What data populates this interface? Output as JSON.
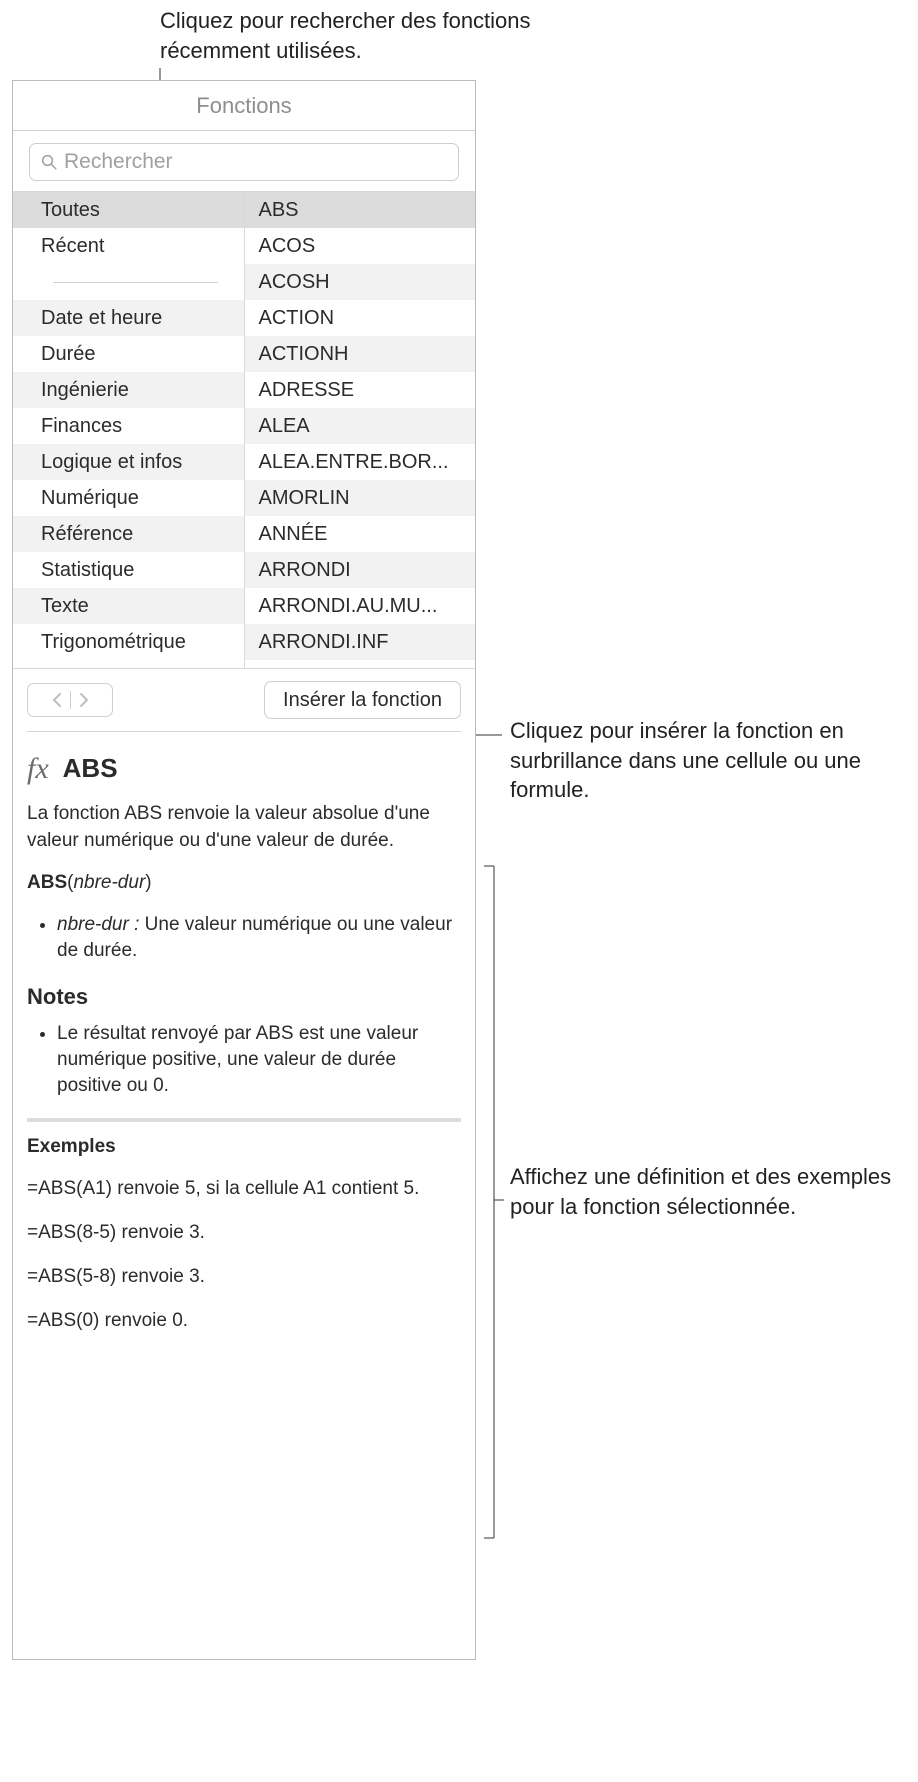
{
  "callouts": {
    "top": "Cliquez pour rechercher des fonctions récemment utilisées.",
    "insert": "Cliquez pour insérer la fonction en surbrillance dans une cellule ou une formule.",
    "definition": "Affichez une définition et des exemples pour la fonction sélectionnée."
  },
  "panel": {
    "title": "Fonctions",
    "search_placeholder": "Rechercher",
    "categories": [
      "Toutes",
      "Récent",
      "",
      "Date et heure",
      "Durée",
      "Ingénierie",
      "Finances",
      "Logique et infos",
      "Numérique",
      "Référence",
      "Statistique",
      "Texte",
      "Trigonométrique"
    ],
    "functions": [
      "ABS",
      "ACOS",
      "ACOSH",
      "ACTION",
      "ACTIONH",
      "ADRESSE",
      "ALEA",
      "ALEA.ENTRE.BOR...",
      "AMORLIN",
      "ANNÉE",
      "ARRONDI",
      "ARRONDI.AU.MU...",
      "ARRONDI.INF"
    ],
    "insert_label": "Insérer la fonction"
  },
  "doc": {
    "fx_symbol": "fx",
    "name": "ABS",
    "summary": "La fonction ABS renvoie la valeur absolue d'une valeur numérique ou d'une valeur de durée.",
    "syntax_name": "ABS",
    "syntax_arg": "nbre-dur",
    "arg_label": "nbre-dur :",
    "arg_desc": "Une valeur numérique ou une valeur de durée.",
    "notes_heading": "Notes",
    "note1": "Le résultat renvoyé par ABS est une valeur numérique positive, une valeur de durée positive ou 0.",
    "examples_heading": "Exemples",
    "examples": [
      "=ABS(A1) renvoie 5, si la cellule A1 contient 5.",
      "=ABS(8-5) renvoie 3.",
      "=ABS(5-8) renvoie 3.",
      "=ABS(0) renvoie 0."
    ]
  }
}
